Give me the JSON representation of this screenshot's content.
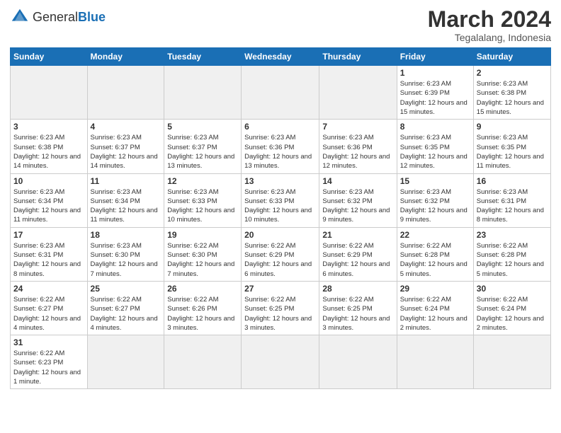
{
  "logo": {
    "general": "General",
    "blue": "Blue"
  },
  "title": "March 2024",
  "subtitle": "Tegalalang, Indonesia",
  "weekdays": [
    "Sunday",
    "Monday",
    "Tuesday",
    "Wednesday",
    "Thursday",
    "Friday",
    "Saturday"
  ],
  "weeks": [
    [
      {
        "day": "",
        "empty": true
      },
      {
        "day": "",
        "empty": true
      },
      {
        "day": "",
        "empty": true
      },
      {
        "day": "",
        "empty": true
      },
      {
        "day": "",
        "empty": true
      },
      {
        "day": "1",
        "info": "Sunrise: 6:23 AM\nSunset: 6:39 PM\nDaylight: 12 hours\nand 15 minutes."
      },
      {
        "day": "2",
        "info": "Sunrise: 6:23 AM\nSunset: 6:38 PM\nDaylight: 12 hours\nand 15 minutes."
      }
    ],
    [
      {
        "day": "3",
        "info": "Sunrise: 6:23 AM\nSunset: 6:38 PM\nDaylight: 12 hours\nand 14 minutes."
      },
      {
        "day": "4",
        "info": "Sunrise: 6:23 AM\nSunset: 6:37 PM\nDaylight: 12 hours\nand 14 minutes."
      },
      {
        "day": "5",
        "info": "Sunrise: 6:23 AM\nSunset: 6:37 PM\nDaylight: 12 hours\nand 13 minutes."
      },
      {
        "day": "6",
        "info": "Sunrise: 6:23 AM\nSunset: 6:36 PM\nDaylight: 12 hours\nand 13 minutes."
      },
      {
        "day": "7",
        "info": "Sunrise: 6:23 AM\nSunset: 6:36 PM\nDaylight: 12 hours\nand 12 minutes."
      },
      {
        "day": "8",
        "info": "Sunrise: 6:23 AM\nSunset: 6:35 PM\nDaylight: 12 hours\nand 12 minutes."
      },
      {
        "day": "9",
        "info": "Sunrise: 6:23 AM\nSunset: 6:35 PM\nDaylight: 12 hours\nand 11 minutes."
      }
    ],
    [
      {
        "day": "10",
        "info": "Sunrise: 6:23 AM\nSunset: 6:34 PM\nDaylight: 12 hours\nand 11 minutes."
      },
      {
        "day": "11",
        "info": "Sunrise: 6:23 AM\nSunset: 6:34 PM\nDaylight: 12 hours\nand 11 minutes."
      },
      {
        "day": "12",
        "info": "Sunrise: 6:23 AM\nSunset: 6:33 PM\nDaylight: 12 hours\nand 10 minutes."
      },
      {
        "day": "13",
        "info": "Sunrise: 6:23 AM\nSunset: 6:33 PM\nDaylight: 12 hours\nand 10 minutes."
      },
      {
        "day": "14",
        "info": "Sunrise: 6:23 AM\nSunset: 6:32 PM\nDaylight: 12 hours\nand 9 minutes."
      },
      {
        "day": "15",
        "info": "Sunrise: 6:23 AM\nSunset: 6:32 PM\nDaylight: 12 hours\nand 9 minutes."
      },
      {
        "day": "16",
        "info": "Sunrise: 6:23 AM\nSunset: 6:31 PM\nDaylight: 12 hours\nand 8 minutes."
      }
    ],
    [
      {
        "day": "17",
        "info": "Sunrise: 6:23 AM\nSunset: 6:31 PM\nDaylight: 12 hours\nand 8 minutes."
      },
      {
        "day": "18",
        "info": "Sunrise: 6:23 AM\nSunset: 6:30 PM\nDaylight: 12 hours\nand 7 minutes."
      },
      {
        "day": "19",
        "info": "Sunrise: 6:22 AM\nSunset: 6:30 PM\nDaylight: 12 hours\nand 7 minutes."
      },
      {
        "day": "20",
        "info": "Sunrise: 6:22 AM\nSunset: 6:29 PM\nDaylight: 12 hours\nand 6 minutes."
      },
      {
        "day": "21",
        "info": "Sunrise: 6:22 AM\nSunset: 6:29 PM\nDaylight: 12 hours\nand 6 minutes."
      },
      {
        "day": "22",
        "info": "Sunrise: 6:22 AM\nSunset: 6:28 PM\nDaylight: 12 hours\nand 5 minutes."
      },
      {
        "day": "23",
        "info": "Sunrise: 6:22 AM\nSunset: 6:28 PM\nDaylight: 12 hours\nand 5 minutes."
      }
    ],
    [
      {
        "day": "24",
        "info": "Sunrise: 6:22 AM\nSunset: 6:27 PM\nDaylight: 12 hours\nand 4 minutes."
      },
      {
        "day": "25",
        "info": "Sunrise: 6:22 AM\nSunset: 6:27 PM\nDaylight: 12 hours\nand 4 minutes."
      },
      {
        "day": "26",
        "info": "Sunrise: 6:22 AM\nSunset: 6:26 PM\nDaylight: 12 hours\nand 3 minutes."
      },
      {
        "day": "27",
        "info": "Sunrise: 6:22 AM\nSunset: 6:25 PM\nDaylight: 12 hours\nand 3 minutes."
      },
      {
        "day": "28",
        "info": "Sunrise: 6:22 AM\nSunset: 6:25 PM\nDaylight: 12 hours\nand 3 minutes."
      },
      {
        "day": "29",
        "info": "Sunrise: 6:22 AM\nSunset: 6:24 PM\nDaylight: 12 hours\nand 2 minutes."
      },
      {
        "day": "30",
        "info": "Sunrise: 6:22 AM\nSunset: 6:24 PM\nDaylight: 12 hours\nand 2 minutes."
      }
    ],
    [
      {
        "day": "31",
        "info": "Sunrise: 6:22 AM\nSunset: 6:23 PM\nDaylight: 12 hours\nand 1 minute."
      },
      {
        "day": "",
        "empty": true
      },
      {
        "day": "",
        "empty": true
      },
      {
        "day": "",
        "empty": true
      },
      {
        "day": "",
        "empty": true
      },
      {
        "day": "",
        "empty": true
      },
      {
        "day": "",
        "empty": true
      }
    ]
  ]
}
